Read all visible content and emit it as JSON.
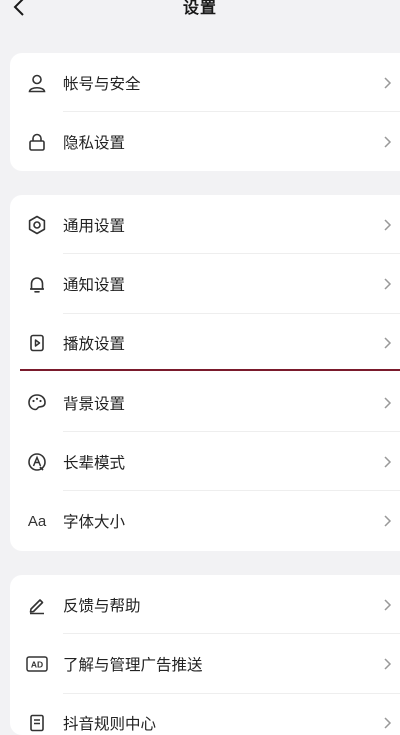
{
  "header": {
    "title": "设置",
    "back_icon": "chevron-left-icon"
  },
  "colors": {
    "background": "#f2f2f4",
    "card": "#ffffff",
    "accent_line": "#7a1a2c"
  },
  "group1": [
    {
      "icon": "user-icon",
      "label": "帐号与安全"
    },
    {
      "icon": "lock-icon",
      "label": "隐私设置"
    }
  ],
  "group2": [
    {
      "icon": "gear-icon",
      "label": "通用设置"
    },
    {
      "icon": "bell-icon",
      "label": "通知设置"
    },
    {
      "icon": "play-icon",
      "label": "播放设置"
    },
    {
      "icon": "palette-icon",
      "label": "背景设置"
    },
    {
      "icon": "elder-mode-icon",
      "label": "长辈模式"
    },
    {
      "icon": "font-size-icon",
      "label": "字体大小",
      "icon_text": "Aa"
    }
  ],
  "group3": [
    {
      "icon": "pen-icon",
      "label": "反馈与帮助"
    },
    {
      "icon": "ad-icon",
      "label": "了解与管理广告推送",
      "icon_text": "AD"
    },
    {
      "icon": "document-icon",
      "label": "抖音规则中心"
    }
  ]
}
